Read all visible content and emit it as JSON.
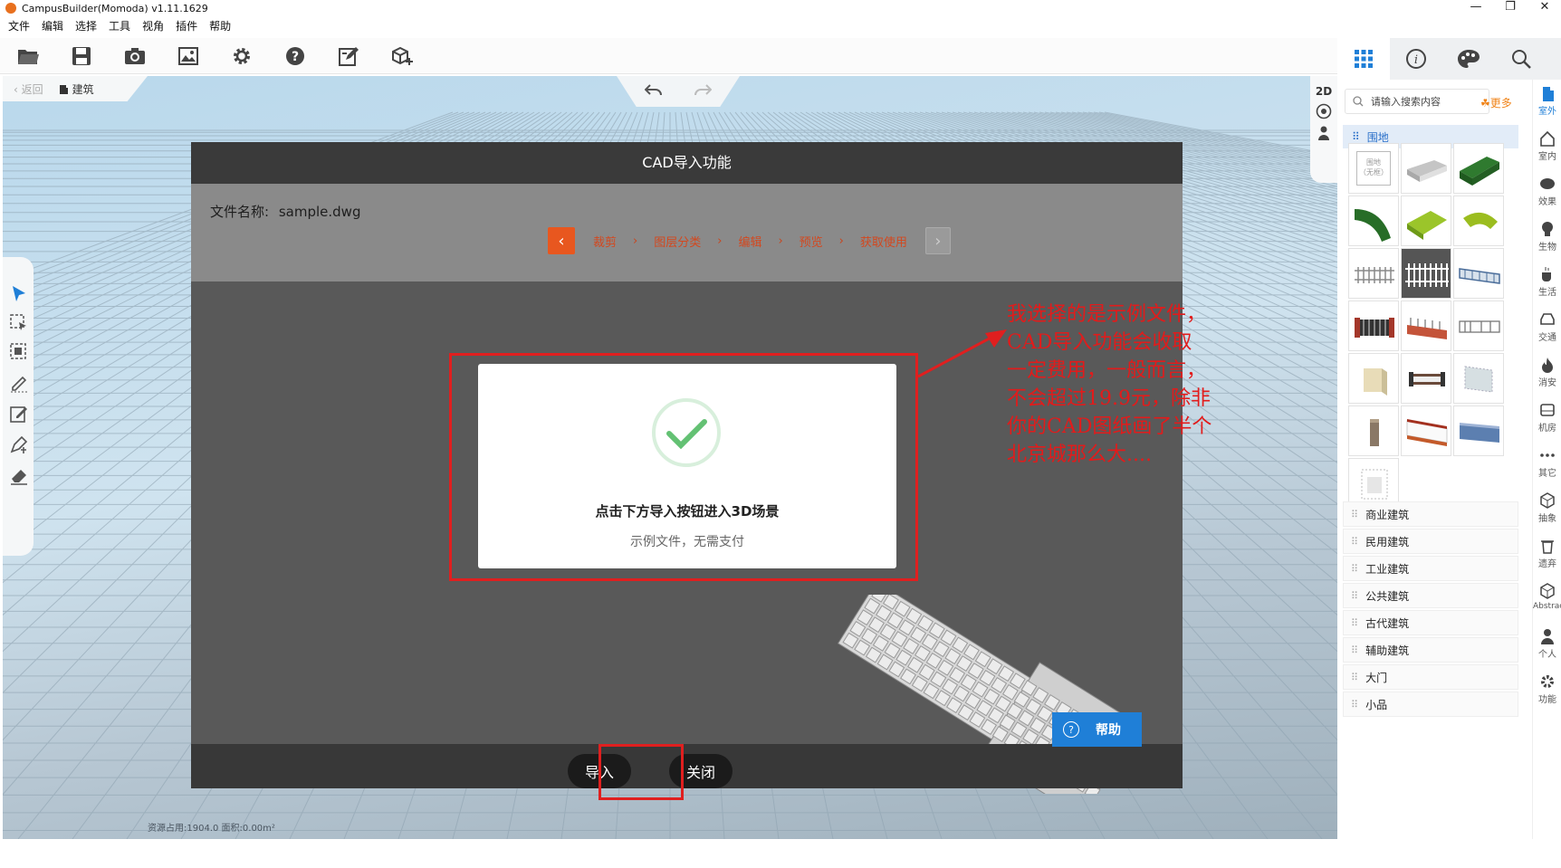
{
  "app": {
    "title": "CampusBuilder(Momoda) v1.11.1629"
  },
  "window_controls": {
    "minimize": "—",
    "restore": "❐",
    "close": "✕"
  },
  "menu": [
    "文件",
    "编辑",
    "选择",
    "工具",
    "视角",
    "插件",
    "帮助"
  ],
  "toolbar_icons": [
    "open-folder-icon",
    "save-icon",
    "camera-icon",
    "image-icon",
    "settings-icon",
    "help-icon",
    "edit-icon",
    "add-model-icon"
  ],
  "viewport": {
    "back_label": "返回",
    "building_label": "建筑",
    "view_mode": "2D",
    "status": "资源占用:1904.0   面积:0.00m²"
  },
  "dialog": {
    "title": "CAD导入功能",
    "file_label": "文件名称:",
    "file_name": "sample.dwg",
    "steps": [
      "裁剪",
      "图层分类",
      "编辑",
      "预览",
      "获取使用"
    ],
    "prev_arrow": "‹",
    "next_arrow": "›",
    "step_separator": "›",
    "success_title": "点击下方导入按钮进入3D场景",
    "success_subtitle": "示例文件，无需支付",
    "help_label": "帮助",
    "help_icon_char": "?",
    "import_label": "导入",
    "close_label": "关闭"
  },
  "annotation": {
    "lines": [
      "我选择的是示例文件，",
      "CAD导入功能会收取",
      "一定费用，一般而言，",
      "不会超过19.9元，除非",
      "你的CAD图纸画了半个",
      "北京城那么大...."
    ]
  },
  "right_panel": {
    "search_placeholder": "请输入搜索内容",
    "more_label": "更多",
    "selected_category": "围地",
    "thumb_placeholder": "围地\n（无框）",
    "categories": [
      "商业建筑",
      "民用建筑",
      "工业建筑",
      "公共建筑",
      "古代建筑",
      "辅助建筑",
      "大门",
      "小品"
    ],
    "side_tabs": [
      "室外",
      "室内",
      "效果",
      "生物",
      "生活",
      "交通",
      "消安",
      "机房",
      "其它",
      "抽象",
      "遗弃",
      "Abstract",
      "个人",
      "功能"
    ]
  },
  "colors": {
    "accent_orange": "#e8571f",
    "annotation_red": "#e01f1f",
    "help_blue": "#1f7fd7",
    "success_green": "#63c173"
  }
}
